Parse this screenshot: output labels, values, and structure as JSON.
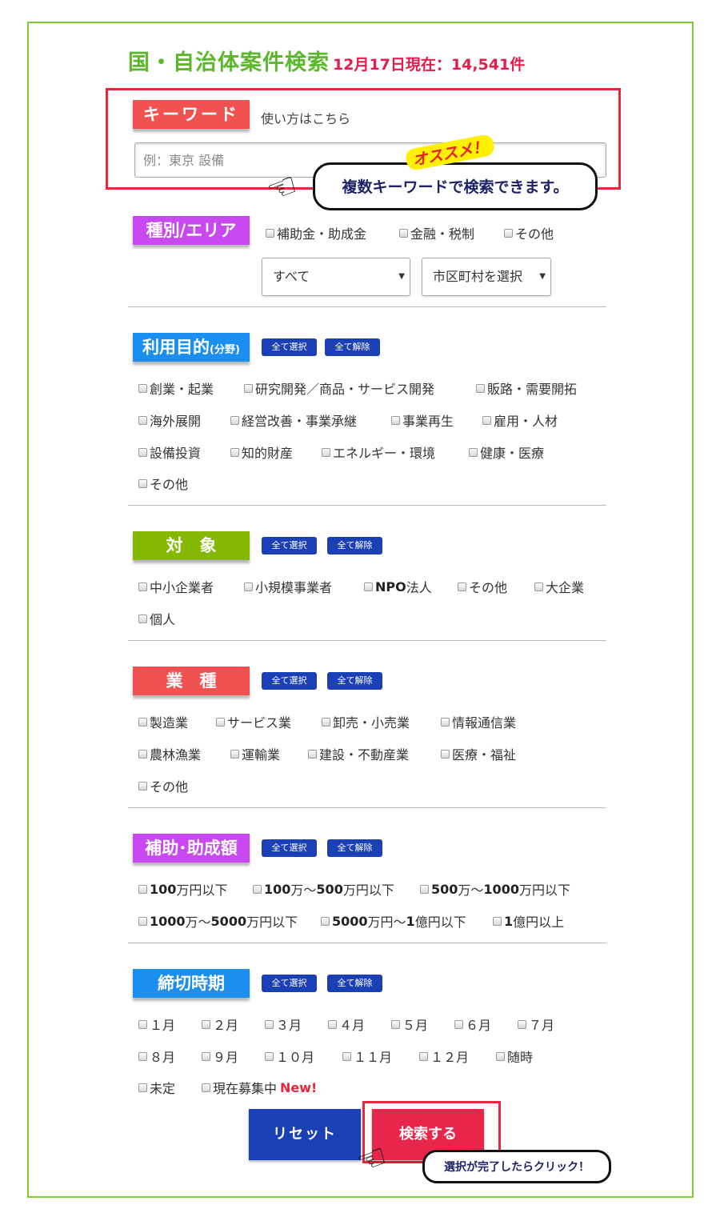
{
  "header": {
    "title": "国・自治体案件検索",
    "count": "12月17日現在：14,541件"
  },
  "keyword": {
    "label": "キーワード",
    "help": "使い方はこちら",
    "placeholder": "例：東京 設備",
    "bubble": "複数キーワードで検索できます。",
    "badge": "オススメ！"
  },
  "area": {
    "label": "種別/エリア",
    "options": [
      "補助金・助成金",
      "金融・税制",
      "その他"
    ],
    "pref_select": "すべて",
    "city_select": "市区町村を選択"
  },
  "bulk": {
    "select_all": "全て選択",
    "clear_all": "全て解除"
  },
  "purpose": {
    "label": "利用目的",
    "label_sub": "(分野)",
    "options": [
      "創業・起業",
      "研究開発／商品・サービス開発",
      "販路・需要開拓",
      "海外展開",
      "経営改善・事業承継",
      "事業再生",
      "雇用・人材",
      "設備投資",
      "知的財産",
      "エネルギー・環境",
      "健康・医療",
      "その他"
    ]
  },
  "target": {
    "label": "対　象",
    "options": [
      "中小企業者",
      "小規模事業者",
      "法人",
      "その他",
      "大企業",
      "個人"
    ],
    "npo_prefix": "NPO"
  },
  "industry": {
    "label": "業　種",
    "options": [
      "製造業",
      "サービス業",
      "卸売・小売業",
      "情報通信業",
      "農林漁業",
      "運輸業",
      "建設・不動産業",
      "医療・福祉",
      "その他"
    ]
  },
  "amount": {
    "label": "補助･助成額",
    "options": [
      {
        "a": "100",
        "b": "万円以下",
        "c": "",
        "d": ""
      },
      {
        "a": "100",
        "b": "万～",
        "c": "500",
        "d": "万円以下"
      },
      {
        "a": "500",
        "b": "万～",
        "c": "1000",
        "d": "万円以下"
      },
      {
        "a": "1000",
        "b": "万～",
        "c": "5000",
        "d": "万円以下"
      },
      {
        "a": "5000",
        "b": "万円～",
        "c": "1",
        "d": "億円以下"
      },
      {
        "a": "1",
        "b": "億円以上",
        "c": "",
        "d": ""
      }
    ]
  },
  "deadline": {
    "label": "締切時期",
    "options": [
      "１月",
      "２月",
      "３月",
      "４月",
      "５月",
      "６月",
      "７月",
      "８月",
      "９月",
      "１０月",
      "１１月",
      "１２月",
      "随時",
      "未定",
      "現在募集中"
    ],
    "new_badge": "New!"
  },
  "actions": {
    "reset": "リセット",
    "search": "検索する",
    "hint": "選択が完了したらクリック！"
  }
}
